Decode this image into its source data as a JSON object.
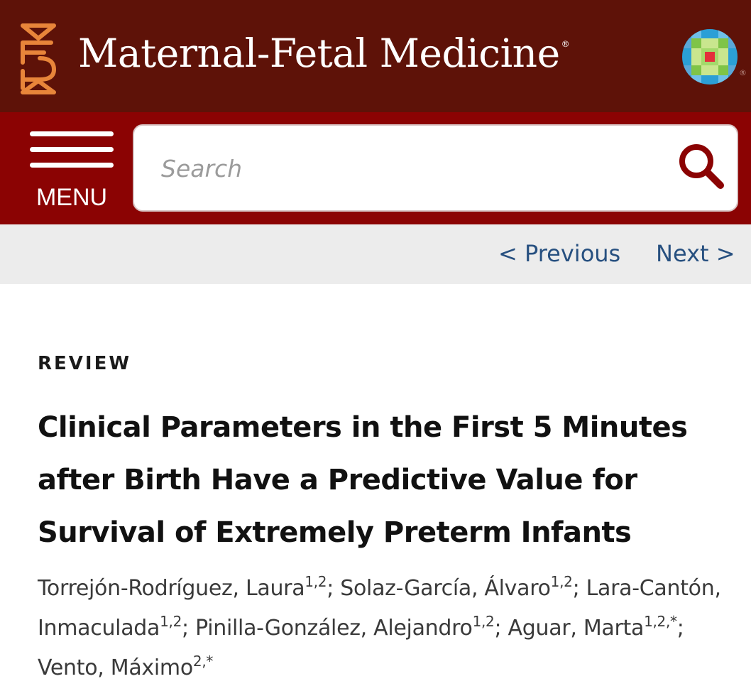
{
  "header": {
    "journal_title": "Maternal-Fetal Medicine",
    "registered_mark": "®",
    "publisher_registered_mark": "®",
    "brand_color": "#5e1208",
    "bar_color": "#8b0303",
    "logo_icon": "maternal-fetal-medicine-logo",
    "publisher_icon": "wolters-kluwer-logo"
  },
  "nav": {
    "menu_label": "MENU",
    "menu_icon": "hamburger-icon",
    "search_placeholder": "Search",
    "search_value": "",
    "search_icon": "magnifier-icon"
  },
  "pager": {
    "previous_label": "< Previous",
    "next_label": "Next >",
    "link_color": "#275080"
  },
  "article": {
    "type": "REVIEW",
    "title": "Clinical Parameters in the First 5 Minutes after Birth Have a Predictive Value for Survival of Extremely Preterm Infants",
    "authors": [
      {
        "name": "Torrejón-Rodríguez, Laura",
        "affiliations": "1,2"
      },
      {
        "name": "Solaz-García, Álvaro",
        "affiliations": "1,2"
      },
      {
        "name": "Lara-Cantón, Inmaculada",
        "affiliations": "1,2"
      },
      {
        "name": "Pinilla-González, Alejandro",
        "affiliations": "1,2"
      },
      {
        "name": "Aguar, Marta",
        "affiliations": "1,2,*"
      },
      {
        "name": "Vento, Máximo",
        "affiliations": "2,*"
      }
    ]
  }
}
